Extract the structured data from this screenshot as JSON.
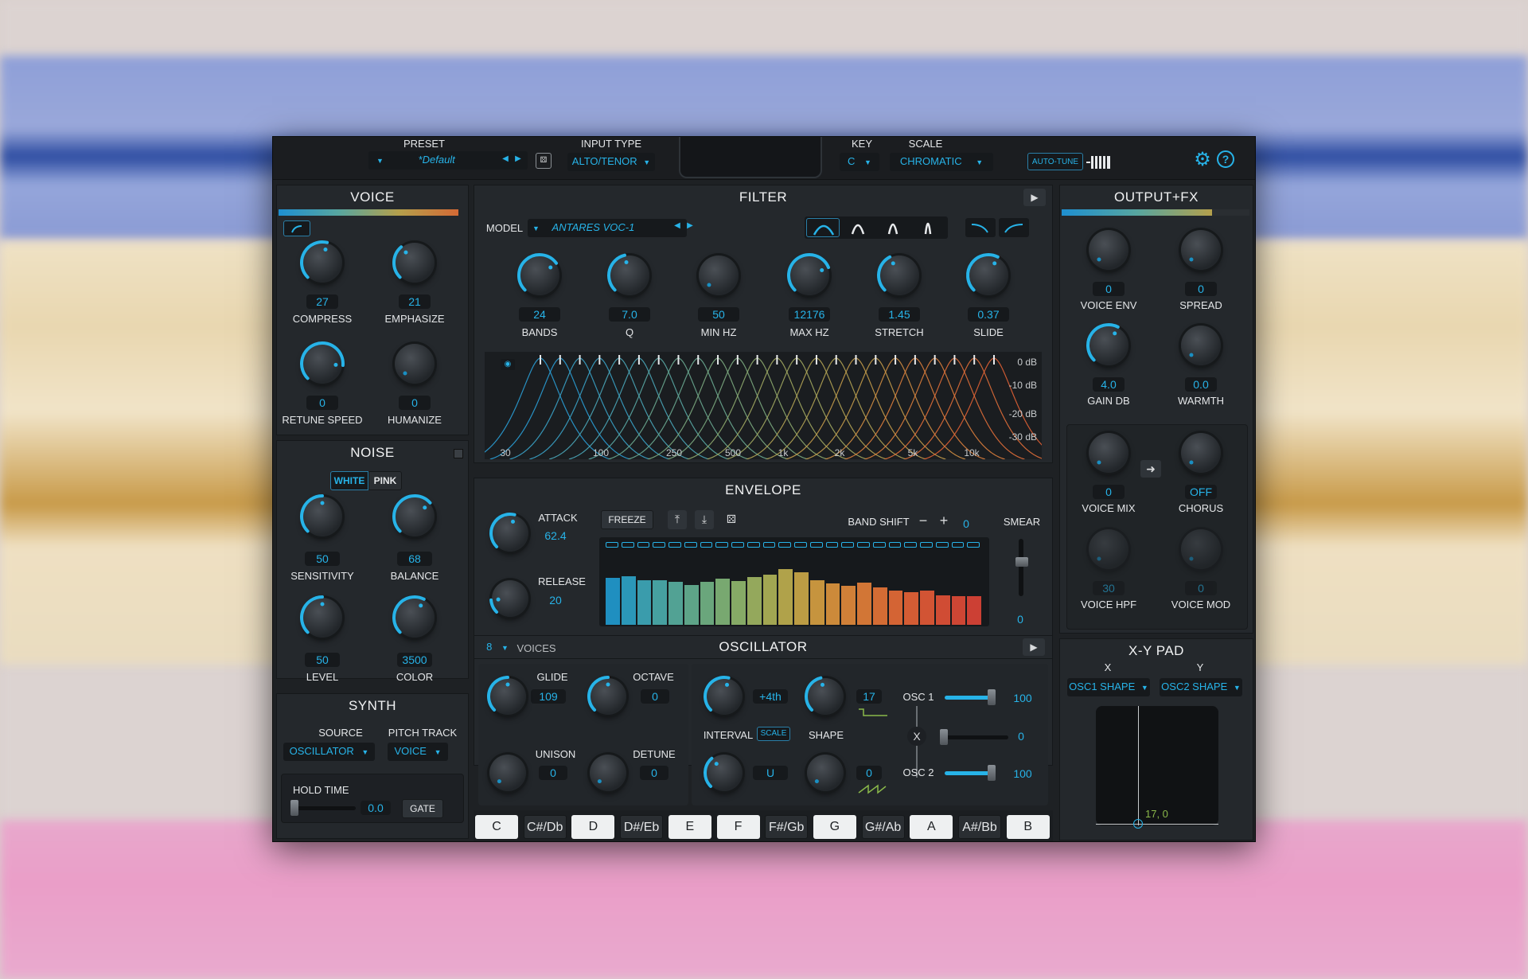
{
  "header": {
    "preset_label": "PRESET",
    "preset_value": "*Default",
    "input_type_label": "INPUT TYPE",
    "input_type_value": "ALTO/TENOR",
    "key_label": "KEY",
    "key_value": "C",
    "scale_label": "SCALE",
    "scale_value": "CHROMATIC",
    "autotune_label": "AUTO-TUNE"
  },
  "voice": {
    "title": "VOICE",
    "knobs": [
      {
        "label": "COMPRESS",
        "value": "27",
        "level": 0.55
      },
      {
        "label": "EMPHASIZE",
        "value": "21",
        "level": 0.35
      },
      {
        "label": "RETUNE SPEED",
        "value": "0",
        "level": 0.85
      },
      {
        "label": "HUMANIZE",
        "value": "0",
        "level": 0.0
      }
    ]
  },
  "noise": {
    "title": "NOISE",
    "white_label": "WHITE",
    "pink_label": "PINK",
    "knobs": [
      {
        "label": "SENSITIVITY",
        "value": "50",
        "level": 0.5
      },
      {
        "label": "BALANCE",
        "value": "68",
        "level": 0.68
      },
      {
        "label": "LEVEL",
        "value": "50",
        "level": 0.5
      },
      {
        "label": "COLOR",
        "value": "3500",
        "level": 0.6
      }
    ]
  },
  "synth": {
    "title": "SYNTH",
    "source_label": "SOURCE",
    "source_value": "OSCILLATOR",
    "pitch_track_label": "PITCH TRACK",
    "pitch_track_value": "VOICE",
    "hold_time_label": "HOLD TIME",
    "hold_time_value": "0.0",
    "gate_label": "GATE"
  },
  "filter": {
    "title": "FILTER",
    "model_label": "MODEL",
    "model_value": "ANTARES VOC-1",
    "knobs": [
      {
        "label": "BANDS",
        "value": "24",
        "level": 0.7
      },
      {
        "label": "Q",
        "value": "7.0",
        "level": 0.45
      },
      {
        "label": "MIN HZ",
        "value": "50",
        "level": 0.0
      },
      {
        "label": "MAX HZ",
        "value": "12176",
        "level": 0.75
      },
      {
        "label": "STRETCH",
        "value": "1.45",
        "level": 0.4
      },
      {
        "label": "SLIDE",
        "value": "0.37",
        "level": 0.6
      }
    ],
    "db_labels": [
      "0 dB",
      "-10 dB",
      "-20 dB",
      "-30 dB"
    ],
    "freq_labels": [
      "30",
      "100",
      "250",
      "500",
      "1k",
      "2k",
      "5k",
      "10k"
    ]
  },
  "envelope": {
    "title": "ENVELOPE",
    "attack_label": "ATTACK",
    "attack_value": "62.4",
    "release_label": "RELEASE",
    "release_value": "20",
    "freeze_label": "FREEZE",
    "band_shift_label": "BAND SHIFT",
    "band_shift_value": "0",
    "smear_label": "SMEAR",
    "smear_value": "0",
    "band_levels": [
      0.59,
      0.61,
      0.56,
      0.56,
      0.54,
      0.5,
      0.54,
      0.58,
      0.55,
      0.6,
      0.63,
      0.7,
      0.66,
      0.56,
      0.52,
      0.49,
      0.53,
      0.47,
      0.43,
      0.41,
      0.43,
      0.37,
      0.36,
      0.36
    ]
  },
  "oscillator": {
    "title": "OSCILLATOR",
    "voices_value": "8",
    "voices_label": "VOICES",
    "glide_label": "GLIDE",
    "glide_value": "109",
    "octave_label": "OCTAVE",
    "octave_value": "0",
    "unison_label": "UNISON",
    "unison_value": "0",
    "detune_label": "DETUNE",
    "detune_value": "0",
    "interval_top_value": "+4th",
    "interval_label": "INTERVAL",
    "scale_btn": "SCALE",
    "interval_bottom_value": "U",
    "shape_top_value": "17",
    "shape_label": "SHAPE",
    "shape_bottom_value": "0",
    "osc1_label": "OSC 1",
    "osc1_value": "100",
    "x_label": "X",
    "x_value": "0",
    "osc2_label": "OSC 2",
    "osc2_value": "100"
  },
  "keys": [
    "C",
    "C#/Db",
    "D",
    "D#/Eb",
    "E",
    "F",
    "F#/Gb",
    "G",
    "G#/Ab",
    "A",
    "A#/Bb",
    "B"
  ],
  "output_fx": {
    "title": "OUTPUT+FX",
    "knobs": [
      {
        "label": "VOICE  ENV",
        "value": "0",
        "level": 0.0
      },
      {
        "label": "SPREAD",
        "value": "0",
        "level": 0.0
      },
      {
        "label": "GAIN DB",
        "value": "4.0",
        "level": 0.6
      },
      {
        "label": "WARMTH",
        "value": "0.0",
        "level": 0.0
      },
      {
        "label": "VOICE MIX",
        "value": "0",
        "level": 0.0
      },
      {
        "label": "CHORUS",
        "value": "OFF",
        "level": 0.0
      },
      {
        "label": "VOICE HPF",
        "value": "30",
        "level": 0.0
      },
      {
        "label": "VOICE MOD",
        "value": "0",
        "level": 0.0
      }
    ]
  },
  "xy_pad": {
    "title": "X-Y PAD",
    "x_label": "X",
    "y_label": "Y",
    "x_value": "OSC1 SHAPE",
    "y_value": "OSC2 SHAPE",
    "readout": "17, 0"
  },
  "colors": {
    "accent": "#27b3e8",
    "panel": "#24282c",
    "background": "#1e2124"
  }
}
